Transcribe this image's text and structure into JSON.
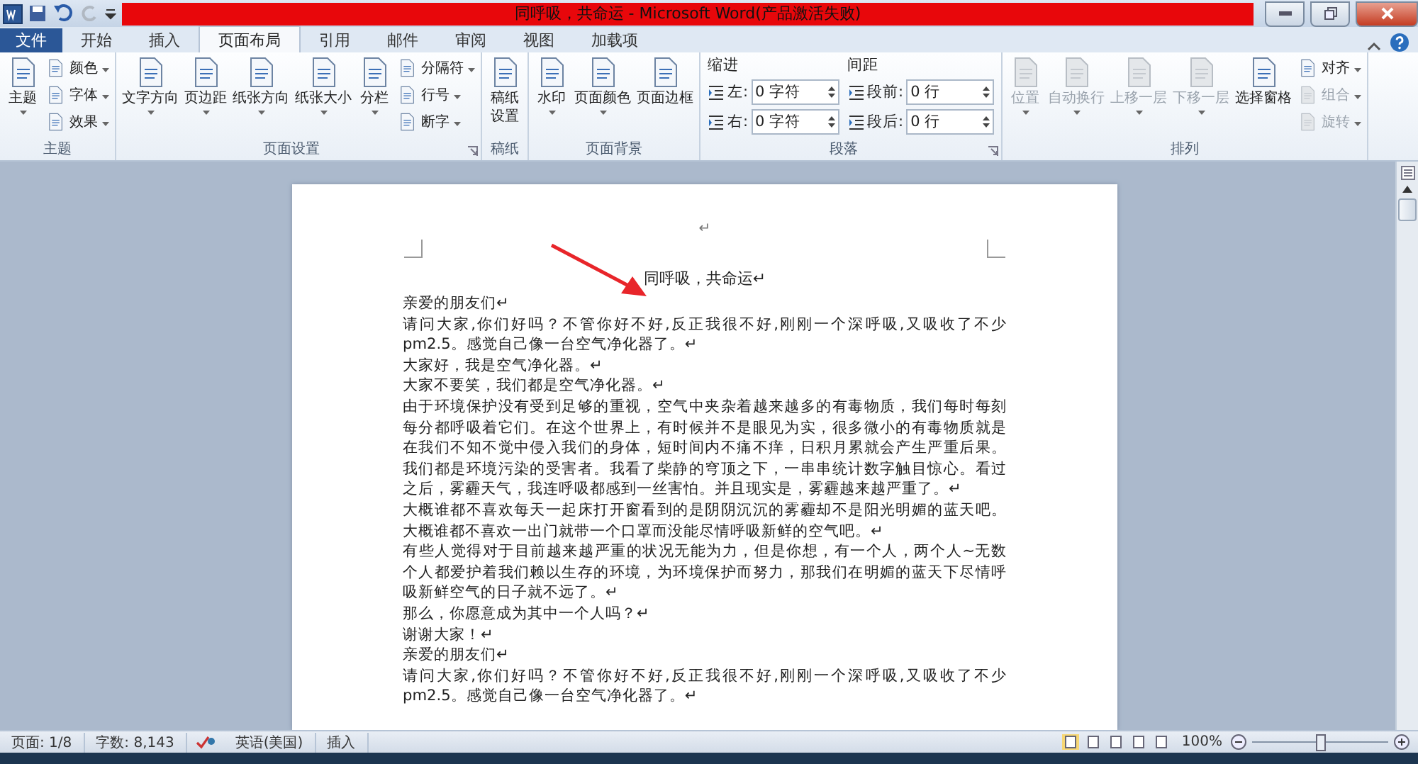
{
  "window": {
    "title": "同呼吸，共命运 - Microsoft Word(产品激活失败)"
  },
  "tabs": [
    {
      "label": "文件",
      "kind": "file",
      "selected": false
    },
    {
      "label": "开始",
      "kind": "tab",
      "selected": false
    },
    {
      "label": "插入",
      "kind": "tab",
      "selected": false
    },
    {
      "label": "页面布局",
      "kind": "tab",
      "selected": true
    },
    {
      "label": "引用",
      "kind": "tab",
      "selected": false
    },
    {
      "label": "邮件",
      "kind": "tab",
      "selected": false
    },
    {
      "label": "审阅",
      "kind": "tab",
      "selected": false
    },
    {
      "label": "视图",
      "kind": "tab",
      "selected": false
    },
    {
      "label": "加载项",
      "kind": "tab",
      "selected": false
    }
  ],
  "ribbon_groups": [
    {
      "label": "主题",
      "kind": "buttons",
      "launcher": false,
      "items": [
        {
          "kind": "large",
          "label": "主题",
          "disabled": false,
          "dropdown": true
        },
        {
          "kind": "small",
          "label": "颜色",
          "disabled": false,
          "dropdown": true
        },
        {
          "kind": "small",
          "label": "字体",
          "disabled": false,
          "dropdown": true
        },
        {
          "kind": "small",
          "label": "效果",
          "disabled": false,
          "dropdown": true
        }
      ]
    },
    {
      "label": "页面设置",
      "kind": "buttons",
      "launcher": true,
      "items": [
        {
          "kind": "large",
          "label": "文字方向",
          "disabled": false,
          "dropdown": true
        },
        {
          "kind": "large",
          "label": "页边距",
          "disabled": false,
          "dropdown": true
        },
        {
          "kind": "large",
          "label": "纸张方向",
          "disabled": false,
          "dropdown": true
        },
        {
          "kind": "large",
          "label": "纸张大小",
          "disabled": false,
          "dropdown": true
        },
        {
          "kind": "large",
          "label": "分栏",
          "disabled": false,
          "dropdown": true
        },
        {
          "kind": "small",
          "label": "分隔符",
          "disabled": false,
          "dropdown": true
        },
        {
          "kind": "small",
          "label": "行号",
          "disabled": false,
          "dropdown": true
        },
        {
          "kind": "small",
          "label": "断字",
          "disabled": false,
          "dropdown": true
        }
      ]
    },
    {
      "label": "稿纸",
      "kind": "buttons",
      "launcher": false,
      "items": [
        {
          "kind": "large",
          "label": "稿纸设置",
          "disabled": false,
          "dropdown": false
        }
      ]
    },
    {
      "label": "页面背景",
      "kind": "buttons",
      "launcher": false,
      "items": [
        {
          "kind": "large",
          "label": "水印",
          "disabled": false,
          "dropdown": true
        },
        {
          "kind": "large",
          "label": "页面颜色",
          "disabled": false,
          "dropdown": true
        },
        {
          "kind": "large",
          "label": "页面边框",
          "disabled": false,
          "dropdown": false
        }
      ]
    },
    {
      "label": "段落",
      "kind": "spacing",
      "launcher": true,
      "columns": [
        {
          "heading": "缩进",
          "fields": [
            {
              "label": "左:",
              "value": "0 字符"
            },
            {
              "label": "右:",
              "value": "0 字符"
            }
          ]
        },
        {
          "heading": "间距",
          "fields": [
            {
              "label": "段前:",
              "value": "0 行"
            },
            {
              "label": "段后:",
              "value": "0 行"
            }
          ]
        }
      ]
    },
    {
      "label": "排列",
      "kind": "buttons",
      "launcher": false,
      "items": [
        {
          "kind": "large",
          "label": "位置",
          "disabled": true,
          "dropdown": true
        },
        {
          "kind": "large",
          "label": "自动换行",
          "disabled": true,
          "dropdown": true
        },
        {
          "kind": "large",
          "label": "上移一层",
          "disabled": true,
          "dropdown": true
        },
        {
          "kind": "large",
          "label": "下移一层",
          "disabled": true,
          "dropdown": true
        },
        {
          "kind": "large",
          "label": "选择窗格",
          "disabled": false,
          "dropdown": false
        },
        {
          "kind": "small",
          "label": "对齐",
          "disabled": false,
          "dropdown": true
        },
        {
          "kind": "small",
          "label": "组合",
          "disabled": true,
          "dropdown": true
        },
        {
          "kind": "small",
          "label": "旋转",
          "disabled": true,
          "dropdown": true
        }
      ]
    }
  ],
  "document": {
    "top_mark": "↵",
    "title": "同呼吸，共命运↵",
    "paragraphs": [
      "亲爱的朋友们↵",
      "请问大家,你们好吗？不管你好不好,反正我很不好,刚刚一个深呼吸,又吸收了不少 pm2.5。感觉自己像一台空气净化器了。↵",
      "大家好，我是空气净化器。↵",
      "大家不要笑，我们都是空气净化器。↵",
      "由于环境保护没有受到足够的重视，空气中夹杂着越来越多的有毒物质，我们每时每刻每分都呼吸着它们。在这个世界上，有时候并不是眼见为实，很多微小的有毒物质就是在我们不知不觉中侵入我们的身体，短时间内不痛不痒，日积月累就会产生严重后果。我们都是环境污染的受害者。我看了柴静的穹顶之下，一串串统计数字触目惊心。看过之后，雾霾天气，我连呼吸都感到一丝害怕。并且现实是，雾霾越来越严重了。↵",
      "大概谁都不喜欢每天一起床打开窗看到的是阴阴沉沉的雾霾却不是阳光明媚的蓝天吧。大概谁都不喜欢一出门就带一个口罩而没能尽情呼吸新鲜的空气吧。↵",
      "有些人觉得对于目前越来越严重的状况无能为力，但是你想，有一个人，两个人~无数个人都爱护着我们赖以生存的环境，为环境保护而努力，那我们在明媚的蓝天下尽情呼吸新鲜空气的日子就不远了。↵",
      "那么，你愿意成为其中一个人吗？↵",
      "谢谢大家！↵",
      "亲爱的朋友们↵",
      "请问大家,你们好吗？不管你好不好,反正我很不好,刚刚一个深呼吸,又吸收了不少 pm2.5。感觉自己像一台空气净化器了。↵"
    ]
  },
  "status_bar": {
    "items": [
      "页面: 1/8",
      "字数: 8,143",
      "英语(美国)",
      "插入"
    ],
    "zoom": {
      "reading": "100%",
      "level": 0.5
    }
  }
}
